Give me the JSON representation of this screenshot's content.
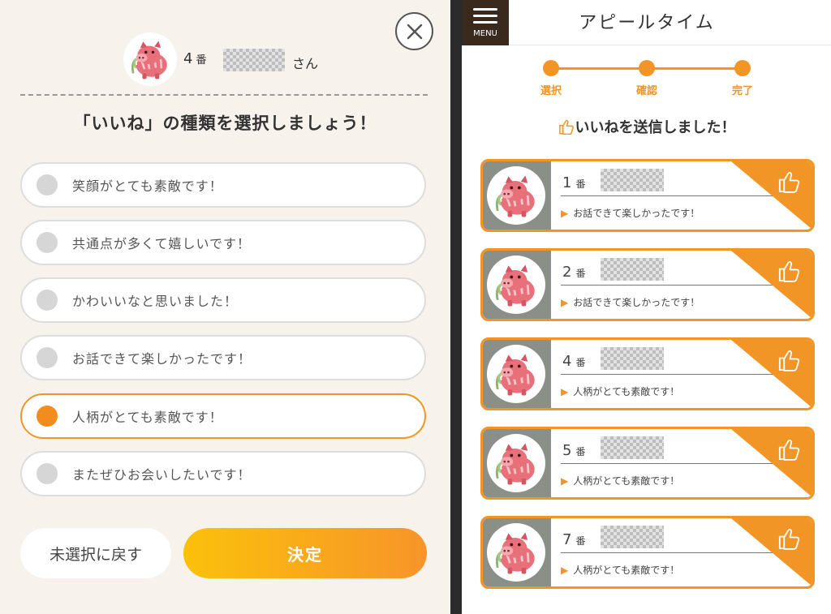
{
  "left": {
    "header": {
      "number": "4",
      "number_unit": "番",
      "suffix": "さん"
    },
    "prompt": "「いいね」の種類を選択しましょう！",
    "options": [
      {
        "label": "笑顔がとても素敵です！",
        "selected": false
      },
      {
        "label": "共通点が多くて嬉しいです！",
        "selected": false
      },
      {
        "label": "かわいいなと思いました！",
        "selected": false
      },
      {
        "label": "お話できて楽しかったです！",
        "selected": false
      },
      {
        "label": "人柄がとても素敵です！",
        "selected": true
      },
      {
        "label": "またぜひお会いしたいです！",
        "selected": false
      }
    ],
    "reset_label": "未選択に戻す",
    "confirm_label": "決定"
  },
  "right": {
    "menu_label": "MENU",
    "title": "アピールタイム",
    "steps": [
      "選択",
      "確認",
      "完了"
    ],
    "sent_message": "いいねを送信しました！",
    "cards": [
      {
        "number": "1",
        "unit": "番",
        "message": "お話できて楽しかったです！"
      },
      {
        "number": "2",
        "unit": "番",
        "message": "お話できて楽しかったです！"
      },
      {
        "number": "4",
        "unit": "番",
        "message": "人柄がとても素敵です！"
      },
      {
        "number": "5",
        "unit": "番",
        "message": "人柄がとても素敵です！"
      },
      {
        "number": "7",
        "unit": "番",
        "message": "人柄がとても素敵です！"
      }
    ]
  },
  "colors": {
    "accent": "#f29527",
    "panel_bg": "#f8f2ec",
    "menu_bg": "#3a2a1e"
  }
}
